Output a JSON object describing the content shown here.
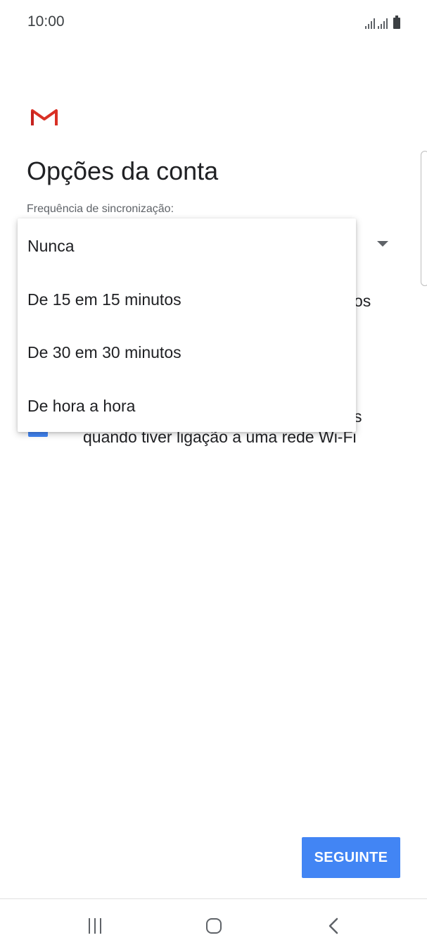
{
  "status_bar": {
    "time": "10:00",
    "icons": [
      "signal-icon",
      "signal-icon",
      "battery-icon"
    ]
  },
  "app": {
    "logo_icon": "gmail-logo-icon",
    "title": "Opções da conta"
  },
  "sync_setting": {
    "label": "Frequência de sincronização:",
    "dropdown_icon": "dropdown-arrow-icon"
  },
  "dropdown_menu": {
    "options": [
      "Nunca",
      "De 15 em 15 minutos",
      "De 30 em 30 minutos",
      "De hora a hora"
    ]
  },
  "occluded_text": {
    "line1_fragment": "os",
    "line2_fragment": "s",
    "line3": "quando tiver ligação a uma rede Wi-Fi"
  },
  "colors": {
    "accent": "#4285f4",
    "gmail_red": "#d93025"
  },
  "footer": {
    "next_label": "SEGUINTE"
  },
  "nav_bar": {
    "recents_icon": "recents-icon",
    "home_icon": "home-icon",
    "back_icon": "back-icon"
  }
}
